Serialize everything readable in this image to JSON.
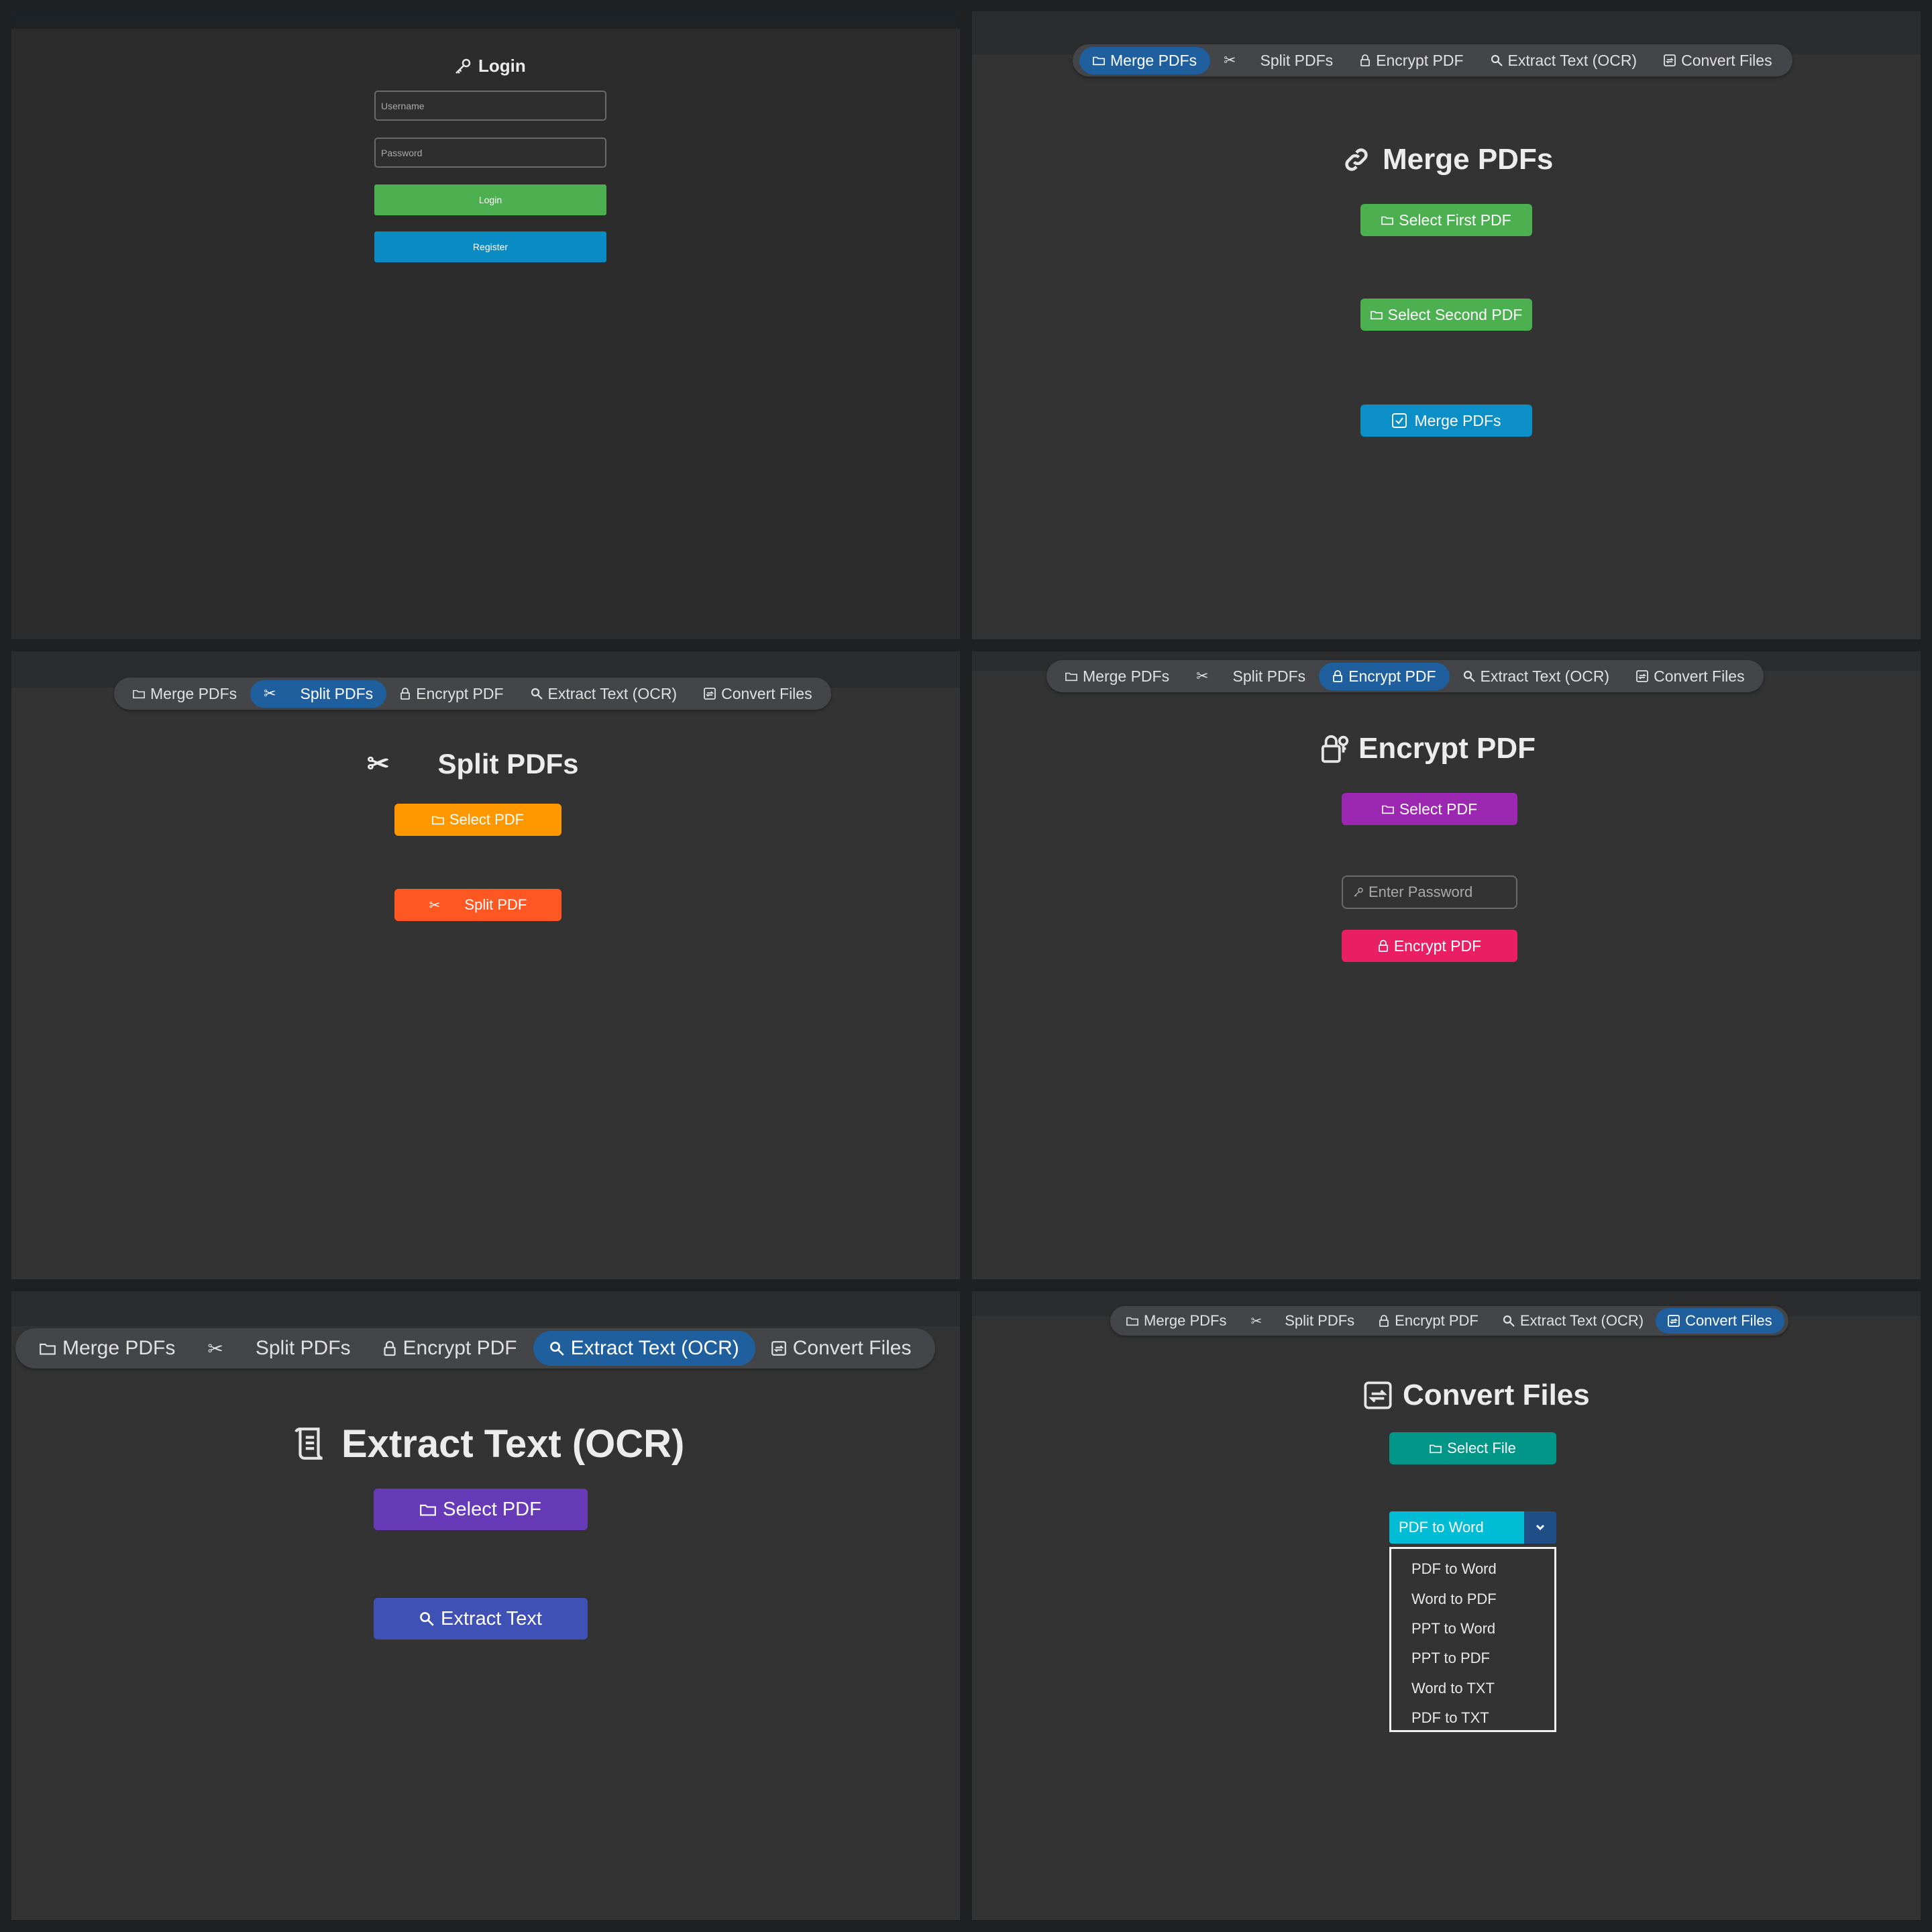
{
  "login": {
    "title": "Login",
    "username_placeholder": "Username",
    "password_placeholder": "Password",
    "login_label": "Login",
    "register_label": "Register"
  },
  "nav": {
    "merge": "Merge PDFs",
    "split": "Split PDFs",
    "encrypt": "Encrypt PDF",
    "extract": "Extract Text (OCR)",
    "convert": "Convert Files"
  },
  "merge_view": {
    "title": "Merge PDFs",
    "select_first": "Select First PDF",
    "select_second": "Select Second PDF",
    "merge_button": "Merge PDFs"
  },
  "split_view": {
    "title": "Split PDFs",
    "select_pdf": "Select PDF",
    "split_button": "Split PDF"
  },
  "encrypt_view": {
    "title": "Encrypt PDF",
    "select_pdf": "Select PDF",
    "password_placeholder": "Enter Password",
    "encrypt_button": "Encrypt PDF"
  },
  "extract_view": {
    "title": "Extract Text (OCR)",
    "select_pdf": "Select PDF",
    "extract_button": "Extract Text"
  },
  "convert_view": {
    "title": "Convert Files",
    "select_file": "Select File",
    "selected": "PDF to Word",
    "options": [
      "PDF to Word",
      "Word to PDF",
      "PPT to Word",
      "PPT to PDF",
      "Word to TXT",
      "PDF to TXT"
    ]
  },
  "colors": {
    "green": "#4caf50",
    "blue": "#0c8ec6",
    "orange": "#ff9800",
    "deep_orange": "#ff5722",
    "purple": "#9c27b0",
    "pink": "#ea1e63",
    "deep_purple": "#673ab7",
    "indigo": "#3f51b5",
    "teal": "#009688",
    "cyan": "#00bcd4",
    "active_tab": "#1f5f9e"
  }
}
